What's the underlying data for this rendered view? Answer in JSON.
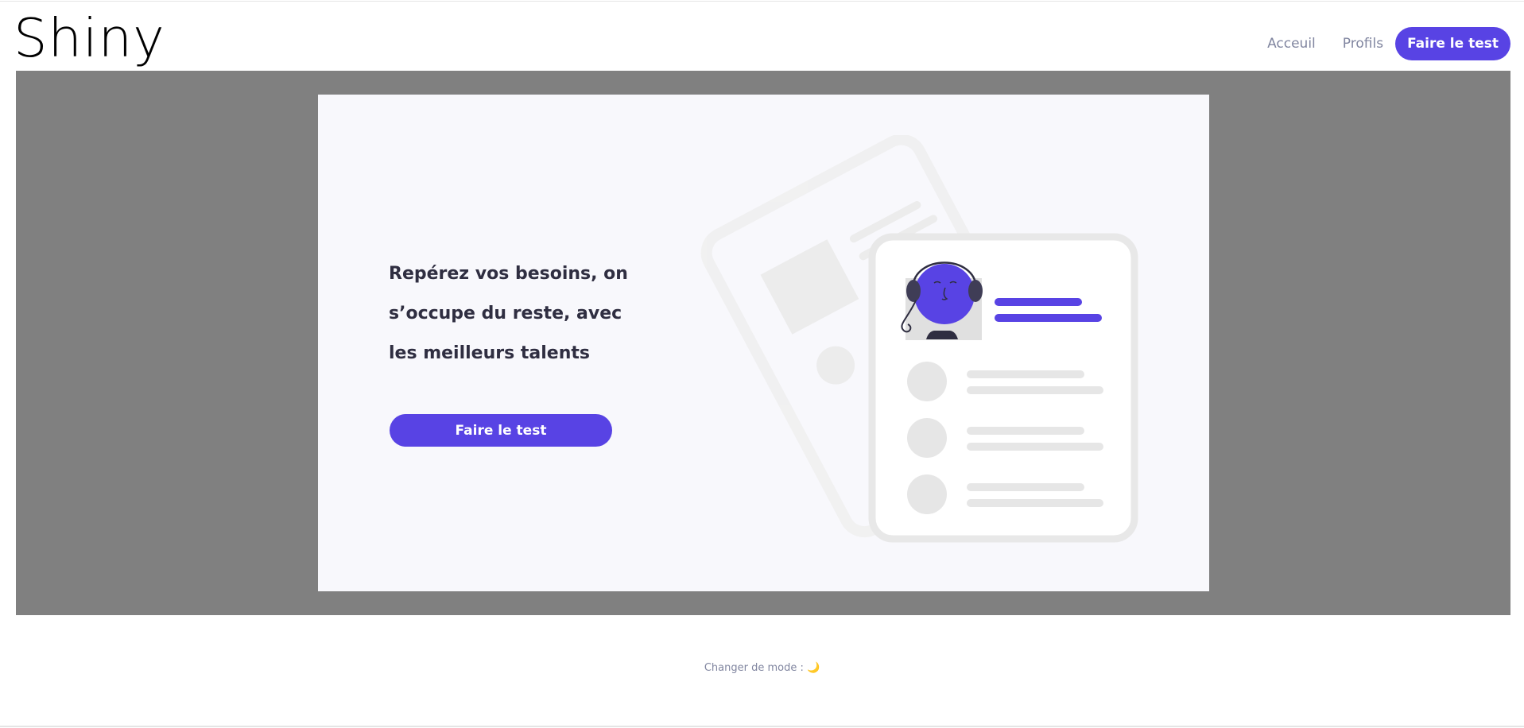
{
  "brand": {
    "logo_text": "Shiny"
  },
  "nav": {
    "items": [
      {
        "label": "Acceuil"
      },
      {
        "label": "Profils"
      }
    ],
    "cta_label": "Faire le test"
  },
  "hero": {
    "headline_lines": [
      "Repérez vos besoins, on",
      "s’occupe du reste, avec",
      "les meilleurs talents"
    ],
    "button_label": "Faire le test",
    "illustration": "profile-card-illustration"
  },
  "footer": {
    "mode_label": "Changer de mode : ",
    "mode_icon": "🌙"
  },
  "colors": {
    "primary": "#5843E4",
    "secondary_text": "#8186A0",
    "hero_backdrop": "#808080",
    "card_bg": "#F8F8FC"
  }
}
